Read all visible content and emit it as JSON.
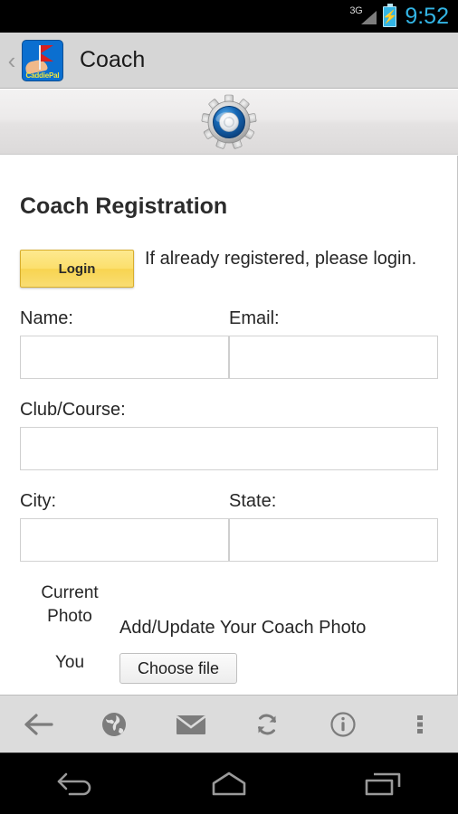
{
  "status_bar": {
    "network_label": "3G",
    "time": "9:52",
    "battery_state": "charging",
    "accent_color": "#33b5e5"
  },
  "title_bar": {
    "back_label": "‹",
    "app_name": "Coach",
    "icon_brand": "CaddiePal"
  },
  "banner": {
    "icon": "gear-icon"
  },
  "page": {
    "heading": "Coach Registration",
    "login_button": "Login",
    "login_note": "If already registered, please login.",
    "fields": {
      "name_label": "Name:",
      "name_value": "",
      "email_label": "Email:",
      "email_value": "",
      "club_label": "Club/Course:",
      "club_value": "",
      "city_label": "City:",
      "city_value": "",
      "state_label": "State:",
      "state_value": ""
    },
    "photo": {
      "current_photo_line1": "Current",
      "current_photo_line2": "Photo",
      "you_label": "You",
      "add_update_text": "Add/Update Your Coach Photo",
      "choose_file_button": "Choose file"
    }
  },
  "toolbar": {
    "items": [
      {
        "name": "back-icon",
        "label": "Back"
      },
      {
        "name": "globe-icon",
        "label": "Browser"
      },
      {
        "name": "mail-icon",
        "label": "Mail"
      },
      {
        "name": "refresh-icon",
        "label": "Refresh"
      },
      {
        "name": "info-icon",
        "label": "Info"
      },
      {
        "name": "overflow-menu-icon",
        "label": "More"
      }
    ],
    "icon_color": "#7c7c7c"
  },
  "nav_bar": {
    "items": [
      {
        "name": "nav-back-icon",
        "label": "Back"
      },
      {
        "name": "nav-home-icon",
        "label": "Home"
      },
      {
        "name": "nav-recents-icon",
        "label": "Recent apps"
      }
    ],
    "icon_color": "#9a9a9a"
  }
}
